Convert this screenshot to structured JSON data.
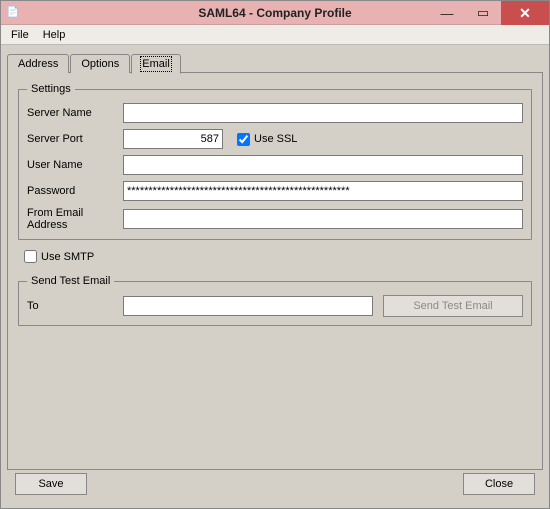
{
  "window": {
    "title": "SAML64 - Company Profile"
  },
  "menu": {
    "file": "File",
    "help": "Help"
  },
  "tabs": {
    "address": "Address",
    "options": "Options",
    "email": "Email"
  },
  "settings": {
    "legend": "Settings",
    "server_name_label": "Server Name",
    "server_name_value": "",
    "server_port_label": "Server Port",
    "server_port_value": "587",
    "use_ssl_label": "Use SSL",
    "use_ssl_checked": true,
    "user_name_label": "User Name",
    "user_name_value": "",
    "password_label": "Password",
    "password_value": "****************************************************",
    "from_email_label": "From Email Address",
    "from_email_value": ""
  },
  "use_smtp": {
    "label": "Use SMTP",
    "checked": false
  },
  "send_test": {
    "legend": "Send Test Email",
    "to_label": "To",
    "to_value": "",
    "button": "Send Test Email"
  },
  "buttons": {
    "save": "Save",
    "close": "Close"
  }
}
